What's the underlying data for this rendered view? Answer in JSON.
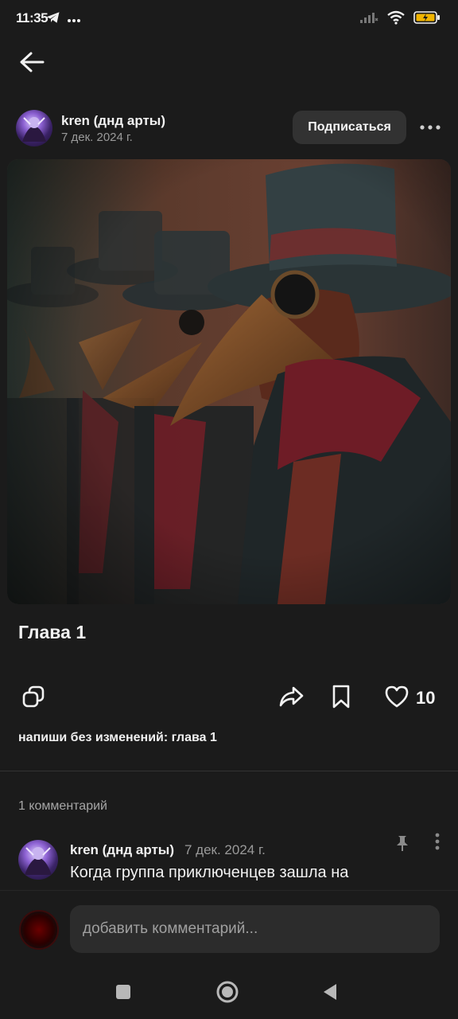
{
  "status_bar": {
    "time": "11:35",
    "icons": [
      "telegram-icon",
      "more-dots-icon",
      "signal-icon",
      "wifi-icon",
      "battery-icon"
    ]
  },
  "header": {
    "back_icon": "arrow-left-icon"
  },
  "post": {
    "author": "kren (днд арты)",
    "date": "7 дек. 2024 г.",
    "subscribe_label": "Подписаться",
    "title": "Глава 1",
    "image_description": "plague doctors",
    "like_count": "10",
    "text": "напиши без изменений: глава 1"
  },
  "comments": {
    "count_label": "1 комментарий",
    "items": [
      {
        "author": "kren (днд арты)",
        "date": "7 дек. 2024 г.",
        "text": "Когда группа приключенцев зашла на"
      }
    ]
  },
  "composer": {
    "placeholder": "добавить комментарий..."
  },
  "colors": {
    "background": "#1b1b1b",
    "button_bg": "#323232",
    "input_bg": "#2c2c2c",
    "secondary_text": "#9a9a9a",
    "battery_fill": "#f0b400"
  }
}
